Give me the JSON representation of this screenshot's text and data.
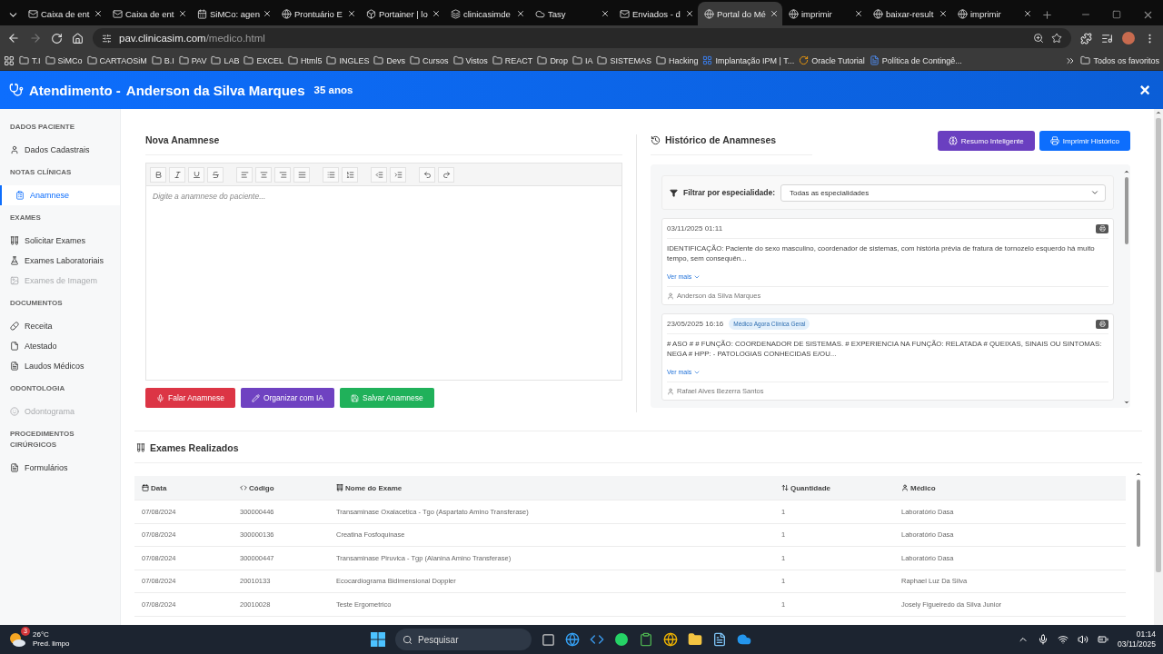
{
  "browser": {
    "tabs": [
      {
        "title": "Caixa de ent",
        "selected": false
      },
      {
        "title": "Caixa de ent",
        "selected": false
      },
      {
        "title": "SiMCo: agen",
        "selected": false
      },
      {
        "title": "Prontuário E",
        "selected": false
      },
      {
        "title": "Portainer | lo",
        "selected": false
      },
      {
        "title": "clinicasimde",
        "selected": false
      },
      {
        "title": "Tasy",
        "selected": false
      },
      {
        "title": "Enviados - d",
        "selected": false
      },
      {
        "title": "Portal do Mé",
        "selected": true
      },
      {
        "title": "imprimir",
        "selected": false
      },
      {
        "title": "baixar-result",
        "selected": false
      },
      {
        "title": "imprimir",
        "selected": false
      }
    ],
    "url_host": "pav.clinicasim.com",
    "url_path": "/medico.html",
    "bookmarks": [
      {
        "label": "T.I",
        "kind": "folder"
      },
      {
        "label": "SiMCo",
        "kind": "folder"
      },
      {
        "label": "CARTAOSiM",
        "kind": "folder"
      },
      {
        "label": "B.I",
        "kind": "folder"
      },
      {
        "label": "PAV",
        "kind": "folder"
      },
      {
        "label": "LAB",
        "kind": "folder"
      },
      {
        "label": "EXCEL",
        "kind": "folder"
      },
      {
        "label": "Html5",
        "kind": "folder"
      },
      {
        "label": "INGLES",
        "kind": "folder"
      },
      {
        "label": "Devs",
        "kind": "folder"
      },
      {
        "label": "Cursos",
        "kind": "folder"
      },
      {
        "label": "Vistos",
        "kind": "folder"
      },
      {
        "label": "REACT",
        "kind": "folder"
      },
      {
        "label": "Drop",
        "kind": "folder"
      },
      {
        "label": "IA",
        "kind": "folder"
      },
      {
        "label": "SISTEMAS",
        "kind": "folder"
      },
      {
        "label": "Hacking",
        "kind": "folder"
      },
      {
        "label": "Implantação IPM | T...",
        "kind": "board"
      },
      {
        "label": "Oracle Tutorial",
        "kind": "power"
      },
      {
        "label": "Política de Contingê...",
        "kind": "doc"
      }
    ],
    "all_bookmarks": "Todos os favoritos"
  },
  "header": {
    "title": "Atendimento -",
    "patient": "Anderson da Silva Marques",
    "age": "35 anos",
    "close": "×"
  },
  "sidebar": [
    {
      "heading": "DADOS PACIENTE",
      "items": [
        {
          "label": "Dados Cadastrais",
          "selected": false,
          "disabled": false
        }
      ]
    },
    {
      "heading": "NOTAS CLÍNICAS",
      "items": [
        {
          "label": "Anamnese",
          "selected": true,
          "disabled": false
        }
      ]
    },
    {
      "heading": "EXAMES",
      "items": [
        {
          "label": "Solicitar Exames",
          "selected": false,
          "disabled": false
        },
        {
          "label": "Exames Laboratoriais",
          "selected": false,
          "disabled": false
        },
        {
          "label": "Exames de Imagem",
          "selected": false,
          "disabled": true
        }
      ]
    },
    {
      "heading": "DOCUMENTOS",
      "items": [
        {
          "label": "Receita",
          "selected": false,
          "disabled": false
        },
        {
          "label": "Atestado",
          "selected": false,
          "disabled": false
        },
        {
          "label": "Laudos Médicos",
          "selected": false,
          "disabled": false
        }
      ]
    },
    {
      "heading": "ODONTOLOGIA",
      "items": [
        {
          "label": "Odontograma",
          "selected": false,
          "disabled": true
        }
      ]
    },
    {
      "heading": "PROCEDIMENTOS CIRÚRGICOS",
      "items": [
        {
          "label": "Formulários",
          "selected": false,
          "disabled": false
        }
      ]
    }
  ],
  "anamnese": {
    "title": "Nova Anamnese",
    "placeholder": "Digite a anamnese do paciente...",
    "buttons": [
      {
        "label": "Falar Anamnese",
        "kind": "voice"
      },
      {
        "label": "Organizar com IA",
        "kind": "ai"
      },
      {
        "label": "Salvar Anamnese",
        "kind": "save"
      }
    ]
  },
  "history": {
    "title": "Histórico de Anamneses",
    "buttons": [
      {
        "label": "Resumo Inteligente",
        "kind": "ai"
      },
      {
        "label": "Imprimir Histórico",
        "kind": "print"
      }
    ],
    "filter_label": "Filtrar por especialidade:",
    "filter_value": "Todas as especialidades",
    "entries": [
      {
        "date": "03/11/2025 01:11",
        "text": "IDENTIFICAÇÃO: Paciente do sexo masculino, coordenador de sistemas, com história prévia de fratura de tornozelo esquerdo há muito tempo, sem consequên...",
        "more": "Ver mais",
        "author": "Anderson da Silva Marques"
      },
      {
        "date": "23/05/2025 16:16",
        "tag": "Médico Agora Clínica Geral",
        "text": "# ASO # # FUNÇÃO: COORDENADOR DE SISTEMAS. # EXPERIENCIA NA FUNÇÃO: RELATADA # QUEIXAS, SINAIS OU SINTOMAS: NEGA # HPP: - PATOLOGIAS CONHECIDAS E/OU...",
        "more": "Ver mais",
        "author": "Rafael Alves Bezerra Santos"
      }
    ]
  },
  "exams": {
    "title": "Exames Realizados",
    "columns": [
      "Data",
      "Código",
      "Nome do Exame",
      "Quantidade",
      "Médico"
    ],
    "rows": [
      [
        "07/08/2024",
        "300000446",
        "Transaminase Oxalacetica - Tgo (Aspartato Amino Transferase)",
        "1",
        "Laboratório Dasa"
      ],
      [
        "07/08/2024",
        "300000136",
        "Creatina Fosfoquinase",
        "1",
        "Laboratório Dasa"
      ],
      [
        "07/08/2024",
        "300000447",
        "Transaminase Piruvica - Tgp (Alanina Amino Transferase)",
        "1",
        "Laboratório Dasa"
      ],
      [
        "07/08/2024",
        "20010133",
        "Ecocardiograma Bidimensional Doppler",
        "1",
        "Raphael Luz Da Silva"
      ],
      [
        "07/08/2024",
        "20010028",
        "Teste Ergometrico",
        "1",
        "Josely Figueiredo da Silva Junior"
      ]
    ]
  },
  "taskbar": {
    "temperature": "26°C",
    "weather": "Pred. limpo",
    "badge": "3",
    "search_placeholder": "Pesquisar",
    "time": "01:14",
    "date": "03/11/2025"
  }
}
